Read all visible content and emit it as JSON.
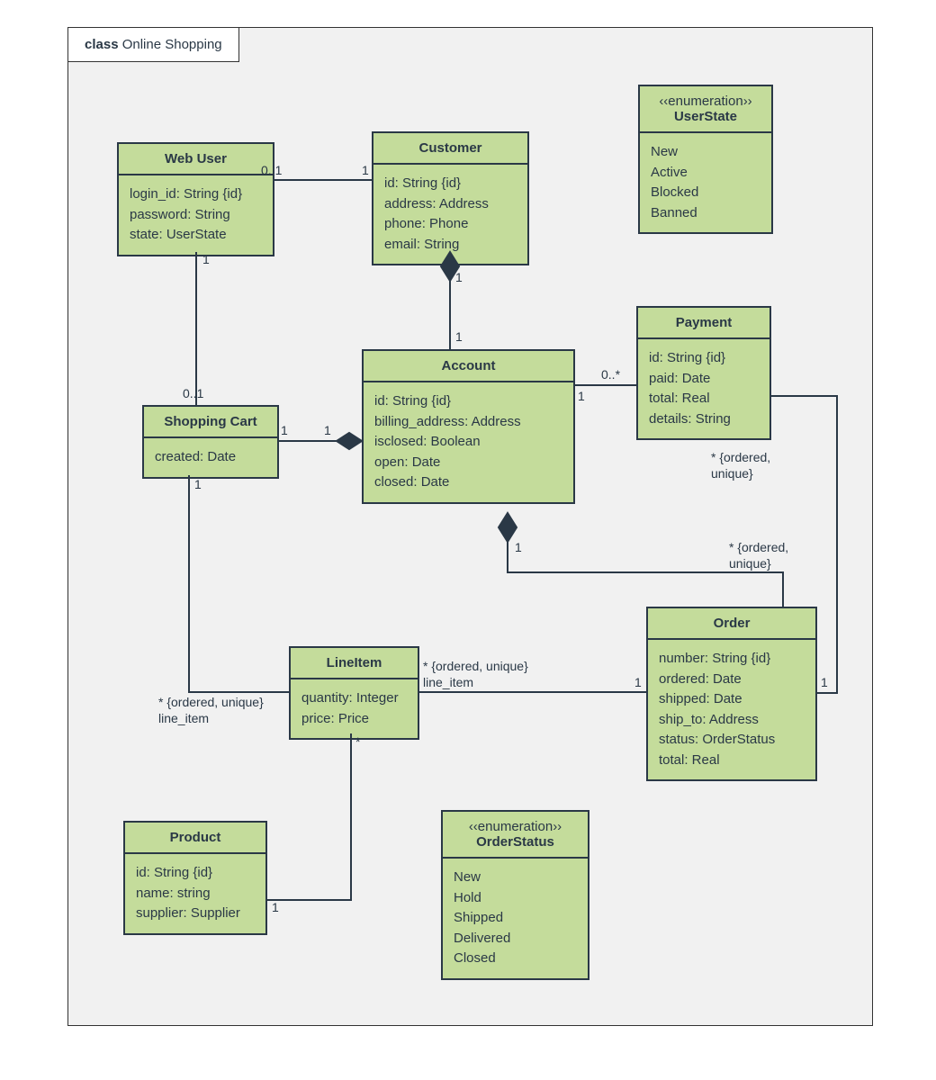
{
  "diagram": {
    "frame_kind": "class",
    "frame_name": "Online Shopping"
  },
  "classes": {
    "web_user": {
      "title": "Web User",
      "attrs": [
        "login_id: String {id}",
        "password: String",
        "state: UserState"
      ]
    },
    "customer": {
      "title": "Customer",
      "attrs": [
        "id: String {id}",
        "address: Address",
        "phone: Phone",
        "email: String"
      ]
    },
    "user_state": {
      "stereotype": "‹‹enumeration››",
      "title": "UserState",
      "attrs": [
        "New",
        "Active",
        "Blocked",
        "Banned"
      ]
    },
    "shopping_cart": {
      "title": "Shopping Cart",
      "attrs": [
        "created: Date"
      ]
    },
    "account": {
      "title": "Account",
      "attrs": [
        "id: String {id}",
        "billing_address: Address",
        "isclosed: Boolean",
        "open: Date",
        "closed: Date"
      ]
    },
    "payment": {
      "title": "Payment",
      "attrs": [
        "id: String {id}",
        "paid: Date",
        "total: Real",
        "details: String"
      ]
    },
    "line_item": {
      "title": "LineItem",
      "attrs": [
        "quantity: Integer",
        "price: Price"
      ]
    },
    "order": {
      "title": "Order",
      "attrs": [
        "number: String {id}",
        "ordered: Date",
        "shipped: Date",
        "ship_to: Address",
        "status: OrderStatus",
        "total: Real"
      ]
    },
    "product": {
      "title": "Product",
      "attrs": [
        "id: String {id}",
        "name: string",
        "supplier: Supplier"
      ]
    },
    "order_status": {
      "stereotype": "‹‹enumeration››",
      "title": "OrderStatus",
      "attrs": [
        "New",
        "Hold",
        "Shipped",
        "Delivered",
        "Closed"
      ]
    }
  },
  "labels": {
    "wu_cust_l": "0..1",
    "wu_cust_r": "1",
    "wu_cart_t": "1",
    "wu_cart_b": "0..1",
    "cust_acct_t": "1",
    "cust_acct_b": "1",
    "acct_cart_l": "1",
    "acct_cart_r": "1",
    "acct_pay_l": "1",
    "acct_pay_r": "0..*",
    "acct_order_l": "1",
    "acct_order_r1": "* {ordered,",
    "acct_order_r2": "unique}",
    "cart_li_t": "1",
    "cart_li_b1": "* {ordered, unique}",
    "cart_li_b2": "line_item",
    "order_li_l1": "* {ordered, unique}",
    "order_li_l2": "line_item",
    "order_li_r": "1",
    "order_pay_r": "1",
    "order_pay_t1": "* {ordered,",
    "order_pay_t2": "unique}",
    "li_prod_t": "*",
    "li_prod_b": "1"
  }
}
